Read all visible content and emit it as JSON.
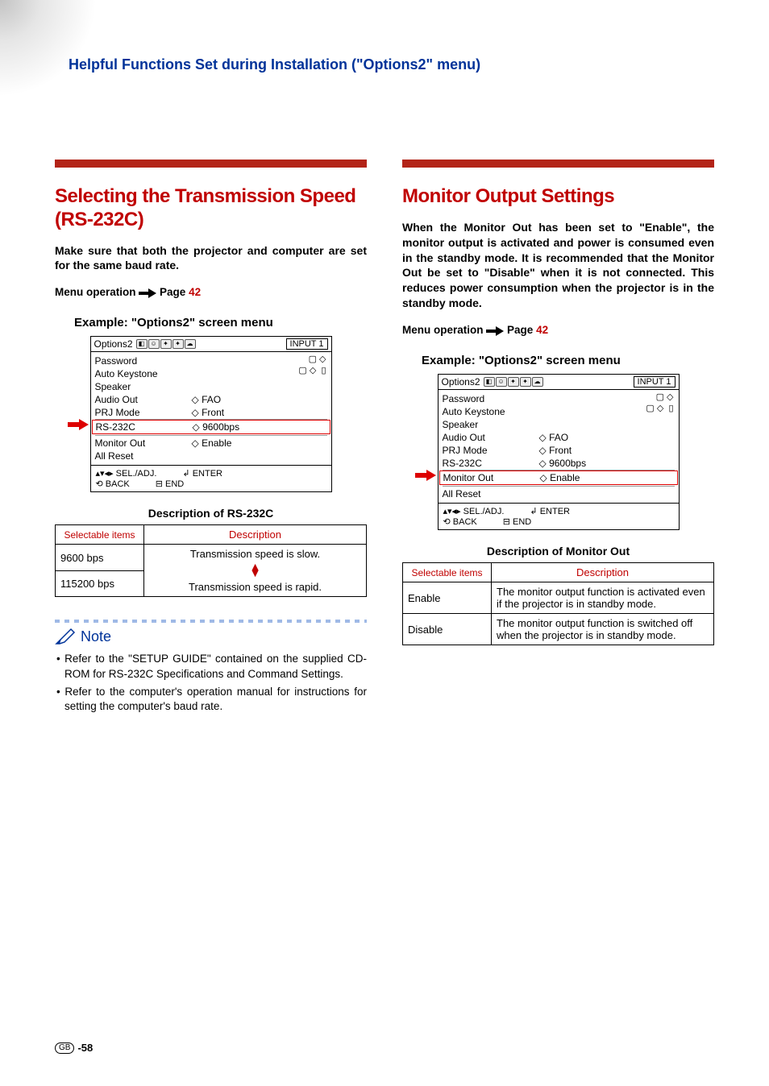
{
  "header": "Helpful Functions Set during Installation (\"Options2\" menu)",
  "footer": {
    "gb": "GB",
    "page": "-58"
  },
  "left": {
    "title": "Selecting the Transmission Speed (RS-232C)",
    "intro": "Make sure that both the projector and computer are set for the same baud rate.",
    "menu_op": {
      "prefix": "Menu operation",
      "page_word": "Page",
      "page_num": "42"
    },
    "example": "Example: \"Options2\" screen menu",
    "menu": {
      "title": "Options2",
      "input": "INPUT 1",
      "items_top": [
        "Password",
        "Auto Keystone",
        "Speaker"
      ],
      "audio": {
        "lbl": "Audio Out",
        "val": "FAO"
      },
      "prj": {
        "lbl": "PRJ Mode",
        "val": "Front"
      },
      "hl": {
        "lbl": "RS-232C",
        "val": "9600bps"
      },
      "mon": {
        "lbl": "Monitor Out",
        "val": "Enable"
      },
      "reset": "All Reset",
      "footer": {
        "sel": "SEL./ADJ.",
        "enter": "ENTER",
        "back": "BACK",
        "end": "END"
      }
    },
    "desc_title": "Description of RS-232C",
    "table": {
      "h1": "Selectable items",
      "h2": "Description",
      "r1": "9600 bps",
      "r2": "115200 bps",
      "d1": "Transmission speed is slow.",
      "d2": "Transmission speed is rapid."
    },
    "note_label": "Note",
    "notes": [
      "Refer to the \"SETUP GUIDE\" contained on the supplied CD-ROM for RS-232C Specifications and Command Settings.",
      "Refer to the computer's operation manual for instructions for setting the computer's baud rate."
    ]
  },
  "right": {
    "title": "Monitor Output Settings",
    "intro": "When the Monitor Out has been set to \"Enable\", the monitor output is activated and power is consumed even in the standby mode. It is recommended that the Monitor Out be set to \"Disable\" when it is not connected. This reduces power consumption when the projector is in the standby mode.",
    "menu_op": {
      "prefix": "Menu operation",
      "page_word": "Page",
      "page_num": "42"
    },
    "example": "Example: \"Options2\" screen menu",
    "menu": {
      "title": "Options2",
      "input": "INPUT 1",
      "items_top": [
        "Password",
        "Auto Keystone",
        "Speaker"
      ],
      "audio": {
        "lbl": "Audio Out",
        "val": "FAO"
      },
      "prj": {
        "lbl": "PRJ Mode",
        "val": "Front"
      },
      "rs": {
        "lbl": "RS-232C",
        "val": "9600bps"
      },
      "hl": {
        "lbl": "Monitor Out",
        "val": "Enable"
      },
      "reset": "All Reset",
      "footer": {
        "sel": "SEL./ADJ.",
        "enter": "ENTER",
        "back": "BACK",
        "end": "END"
      }
    },
    "desc_title": "Description of Monitor Out",
    "table": {
      "h1": "Selectable items",
      "h2": "Description",
      "r1": "Enable",
      "d1": "The monitor output function is activated even if the projector is in standby mode.",
      "r2": "Disable",
      "d2": "The monitor output function is switched off when the projector is in standby mode."
    }
  }
}
